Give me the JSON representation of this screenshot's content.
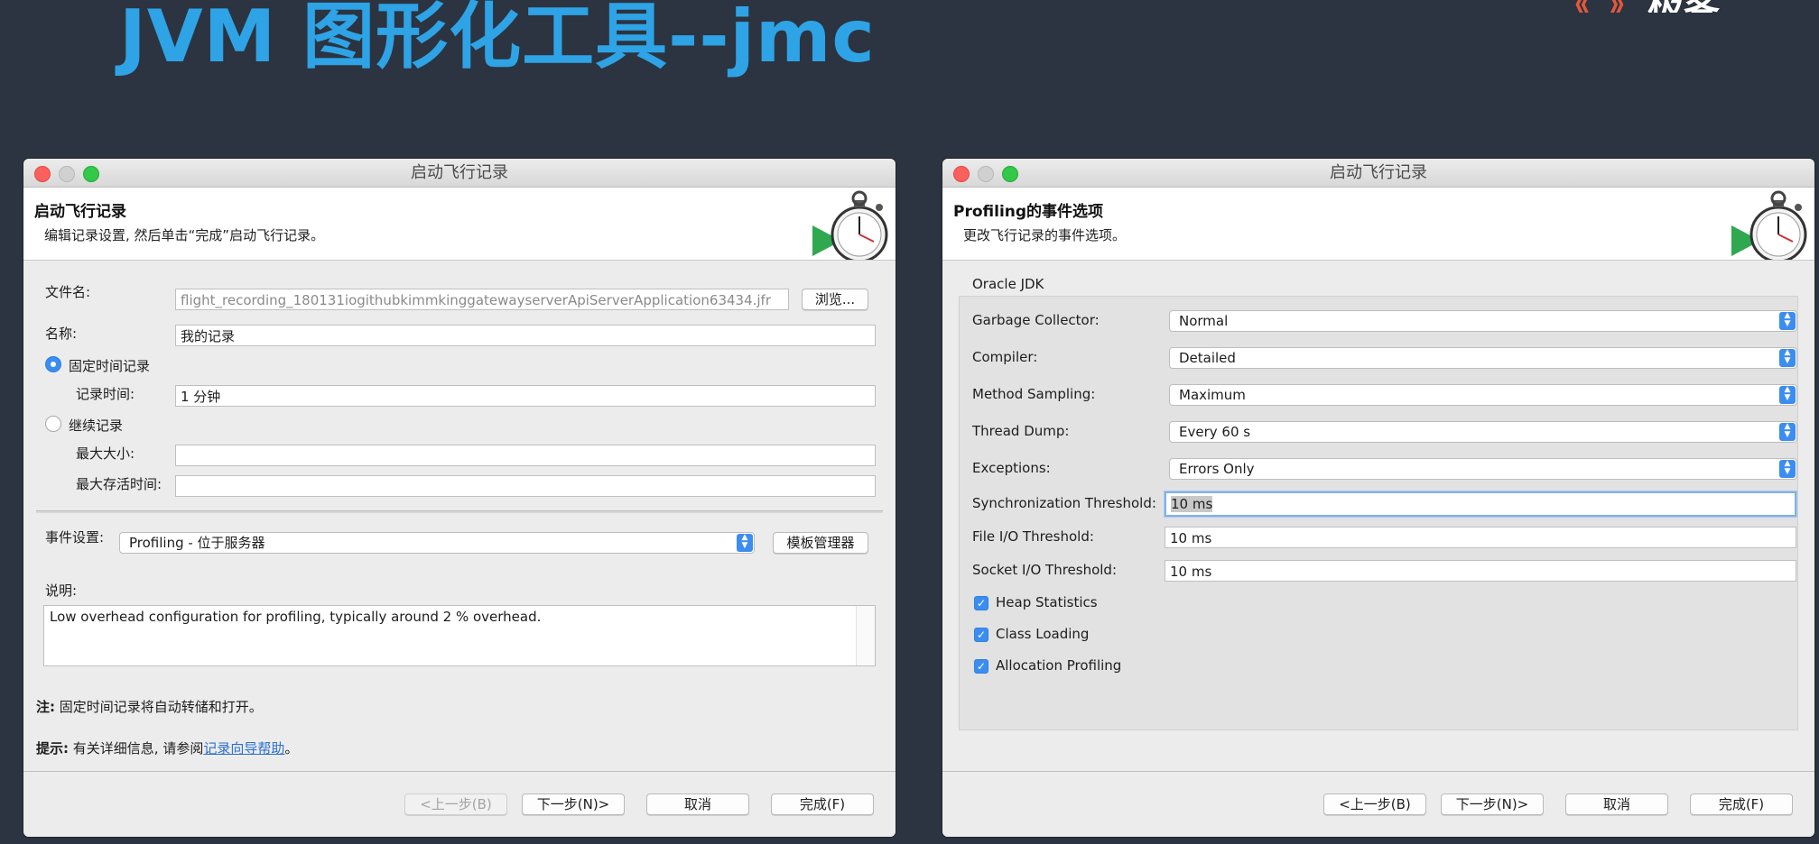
{
  "slide": {
    "title": "JVM 图形化工具--jmc"
  },
  "left_window": {
    "title": "启动飞行记录",
    "header_title": "启动飞行记录",
    "header_subtitle": "编辑记录设置, 然后单击“完成”启动飞行记录。",
    "filename_label": "文件名:",
    "filename_value": "flight_recording_180131iogithubkimmkinggatewayserverApiServerApplication63434.jfr",
    "browse_button": "浏览...",
    "name_label": "名称:",
    "name_value": "我的记录",
    "fixed_time_radio": "固定时间记录",
    "record_time_label": "记录时间:",
    "record_time_value": "1 分钟",
    "continuous_radio": "继续记录",
    "max_size_label": "最大大小:",
    "max_age_label": "最大存活时间:",
    "event_settings_label": "事件设置:",
    "event_settings_value": "Profiling - 位于服务器",
    "template_manager_button": "模板管理器",
    "description_label": "说明:",
    "description_value": "Low overhead configuration for profiling, typically around 2 % overhead.",
    "note_prefix": "注:",
    "note_text": "固定时间记录将自动转储和打开。",
    "hint_prefix": "提示:",
    "hint_text": "有关详细信息, 请参阅",
    "hint_link": "记录向导帮助",
    "hint_suffix": "。",
    "buttons": {
      "back": "<上一步(B)",
      "next": "下一步(N)>",
      "cancel": "取消",
      "finish": "完成(F)"
    }
  },
  "right_window": {
    "title": "启动飞行记录",
    "header_title": "Profiling的事件选项",
    "header_subtitle": "更改飞行记录的事件选项。",
    "group_label": "Oracle JDK",
    "options": [
      {
        "label": "Garbage Collector:",
        "value": "Normal"
      },
      {
        "label": "Compiler:",
        "value": "Detailed"
      },
      {
        "label": "Method Sampling:",
        "value": "Maximum"
      },
      {
        "label": "Thread Dump:",
        "value": "Every 60 s"
      },
      {
        "label": "Exceptions:",
        "value": "Errors Only"
      }
    ],
    "thresholds": [
      {
        "label": "Synchronization Threshold:",
        "value": "10 ms"
      },
      {
        "label": "File I/O Threshold:",
        "value": "10 ms"
      },
      {
        "label": "Socket I/O Threshold:",
        "value": "10 ms"
      }
    ],
    "checkboxes": [
      {
        "label": "Heap Statistics",
        "checked": true
      },
      {
        "label": "Class Loading",
        "checked": true
      },
      {
        "label": "Allocation Profiling",
        "checked": true
      }
    ],
    "buttons": {
      "back": "<上一步(B)",
      "next": "下一步(N)>",
      "cancel": "取消",
      "finish": "完成(F)"
    }
  },
  "colors": {
    "title_blue": "#2ea3e6",
    "background": "#2b3440",
    "accent": "#3b8df0"
  }
}
